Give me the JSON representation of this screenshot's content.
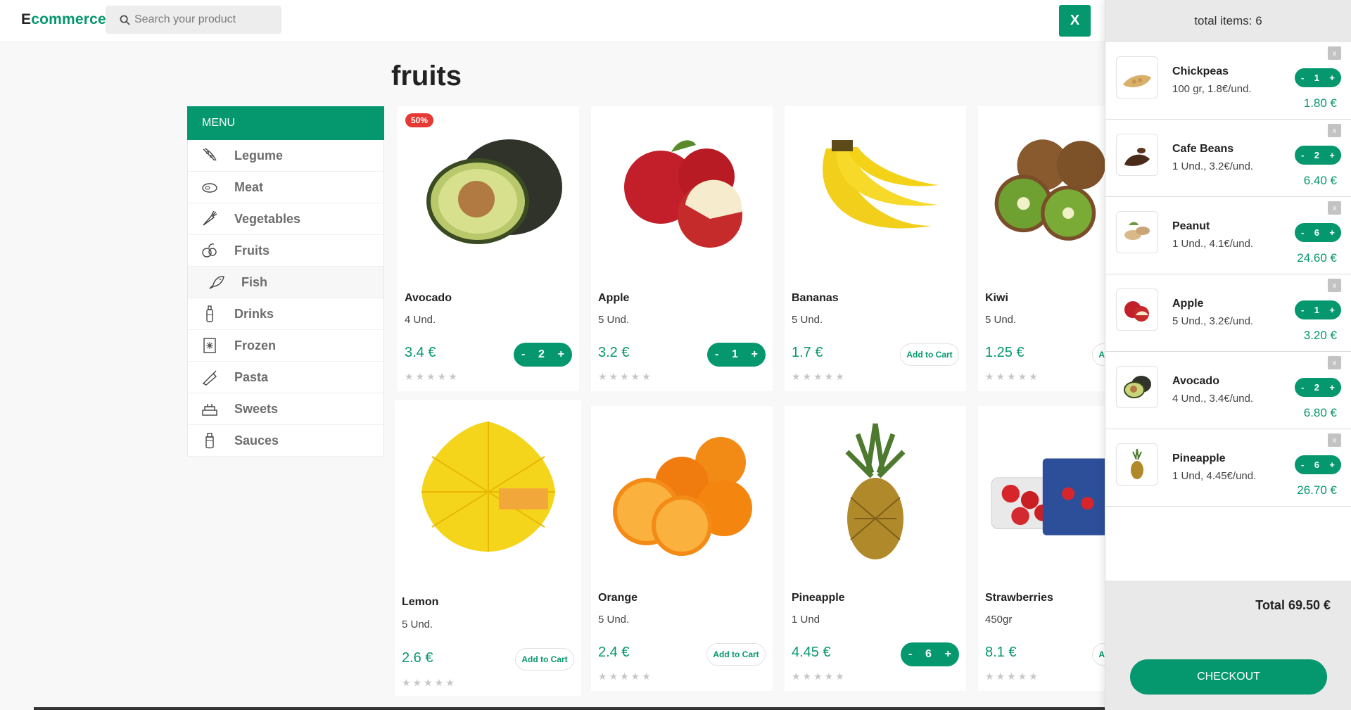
{
  "header": {
    "logo_first": "E",
    "logo_rest": "commerce",
    "search_placeholder": "Search your product",
    "close_label": "X"
  },
  "page_title": "fruits",
  "menu": {
    "title": "MENU",
    "items": [
      {
        "label": "Legume",
        "icon": "legume-icon"
      },
      {
        "label": "Meat",
        "icon": "meat-icon"
      },
      {
        "label": "Vegetables",
        "icon": "vegetables-icon"
      },
      {
        "label": "Fruits",
        "icon": "fruits-icon"
      },
      {
        "label": "Fish",
        "icon": "fish-icon",
        "active": true
      },
      {
        "label": "Drinks",
        "icon": "drinks-icon"
      },
      {
        "label": "Frozen",
        "icon": "frozen-icon"
      },
      {
        "label": "Pasta",
        "icon": "pasta-icon"
      },
      {
        "label": "Sweets",
        "icon": "sweets-icon"
      },
      {
        "label": "Sauces",
        "icon": "sauces-icon"
      }
    ]
  },
  "products": [
    {
      "name": "Avocado",
      "unit": "4 Und.",
      "price": "3.4 €",
      "qty": "2",
      "badge": "50%",
      "stars": "★★★★★"
    },
    {
      "name": "Apple",
      "unit": "5 Und.",
      "price": "3.2 €",
      "qty": "1",
      "stars": "★★★★★"
    },
    {
      "name": "Bananas",
      "unit": "5 Und.",
      "price": "1.7 €",
      "add_label": "Add to Cart",
      "stars": "★★★★★"
    },
    {
      "name": "Kiwi",
      "unit": "5 Und.",
      "price": "1.25 €",
      "add_label": "Add to Cart",
      "stars": "★★★★★"
    },
    {
      "name": "Lemon",
      "unit": "5 Und.",
      "price": "2.6 €",
      "add_label": "Add to Cart",
      "stars": "★★★★★"
    },
    {
      "name": "Orange",
      "unit": "5 Und.",
      "price": "2.4 €",
      "add_label": "Add to Cart",
      "stars": "★★★★★"
    },
    {
      "name": "Pineapple",
      "unit": "1 Und",
      "price": "4.45 €",
      "qty": "6",
      "stars": "★★★★★"
    },
    {
      "name": "Strawberries",
      "unit": "450gr",
      "price": "8.1 €",
      "add_label": "Add to Cart",
      "stars": "★★★★★"
    }
  ],
  "qty_minus": "-",
  "qty_plus": "+",
  "cart": {
    "header": "total items: 6",
    "remove_label": "x",
    "items": [
      {
        "name": "Chickpeas",
        "desc": "100 gr, 1.8€/und.",
        "qty": "1",
        "total": "1.80 €"
      },
      {
        "name": "Cafe Beans",
        "desc": "1 Und., 3.2€/und.",
        "qty": "2",
        "total": "6.40 €"
      },
      {
        "name": "Peanut",
        "desc": "1 Und., 4.1€/und.",
        "qty": "6",
        "total": "24.60 €"
      },
      {
        "name": "Apple",
        "desc": "5 Und., 3.2€/und.",
        "qty": "1",
        "total": "3.20 €"
      },
      {
        "name": "Avocado",
        "desc": "4 Und., 3.4€/und.",
        "qty": "2",
        "total": "6.80 €"
      },
      {
        "name": "Pineapple",
        "desc": "1 Und, 4.45€/und.",
        "qty": "6",
        "total": "26.70 €"
      }
    ],
    "total": "Total 69.50 €",
    "checkout_label": "CHECKOUT"
  },
  "colors": {
    "accent": "#05976e",
    "badge": "#e53935"
  }
}
